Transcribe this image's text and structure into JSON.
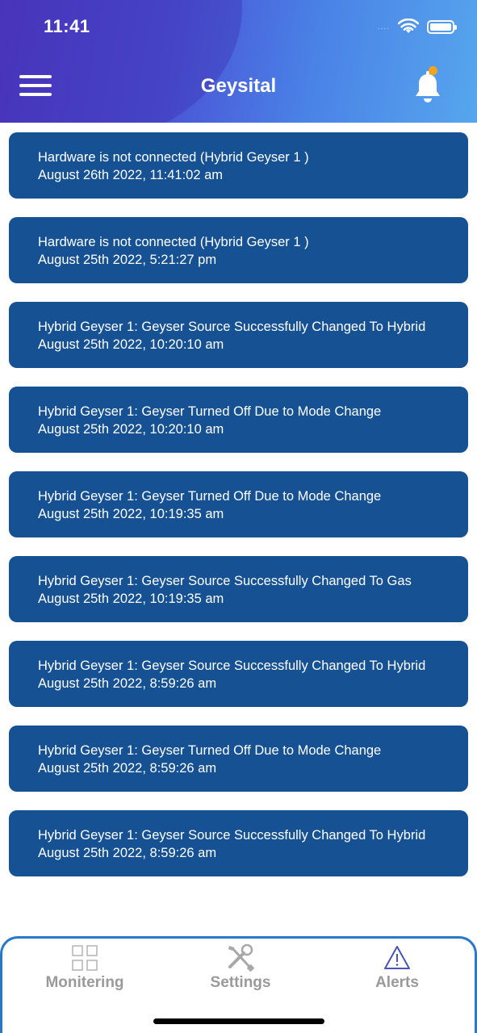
{
  "status_bar": {
    "time": "11:41",
    "signal_dots": "....",
    "icons": [
      "wifi-icon",
      "battery-icon"
    ]
  },
  "header": {
    "title": "Geysital",
    "menu_icon": "hamburger-menu-icon",
    "bell_icon": "bell-icon",
    "notification_dot_color": "#f3a51a",
    "gradient": [
      "#4f3bc4",
      "#56a6ee"
    ]
  },
  "alerts": [
    {
      "message": "Hardware is not connected (Hybrid Geyser 1 )",
      "time": "August 26th 2022, 11:41:02 am"
    },
    {
      "message": "Hardware is not connected (Hybrid Geyser 1 )",
      "time": "August 25th 2022, 5:21:27 pm"
    },
    {
      "message": "Hybrid Geyser 1: Geyser Source Successfully Changed To Hybrid",
      "time": "August 25th 2022, 10:20:10 am"
    },
    {
      "message": "Hybrid Geyser 1: Geyser Turned Off Due to Mode Change",
      "time": "August 25th 2022, 10:20:10 am"
    },
    {
      "message": "Hybrid Geyser 1: Geyser Turned Off Due to Mode Change",
      "time": "August 25th 2022, 10:19:35 am"
    },
    {
      "message": "Hybrid Geyser 1: Geyser Source Successfully Changed To Gas",
      "time": "August 25th 2022, 10:19:35 am"
    },
    {
      "message": "Hybrid Geyser 1: Geyser Source Successfully Changed To Hybrid",
      "time": "August 25th 2022, 8:59:26 am"
    },
    {
      "message": "Hybrid Geyser 1: Geyser Turned Off Due to Mode Change",
      "time": "August 25th 2022, 8:59:26 am"
    },
    {
      "message": "Hybrid Geyser 1: Geyser Source Successfully Changed To Hybrid",
      "time": "August 25th 2022, 8:59:26 am"
    }
  ],
  "alert_card_color": "#165293",
  "tabbar": {
    "border_color": "#2a78c9",
    "tabs": [
      {
        "label": "Monitering",
        "icon": "grid-icon"
      },
      {
        "label": "Settings",
        "icon": "tools-icon"
      },
      {
        "label": "Alerts",
        "icon": "warning-triangle-icon",
        "active": true
      }
    ]
  }
}
